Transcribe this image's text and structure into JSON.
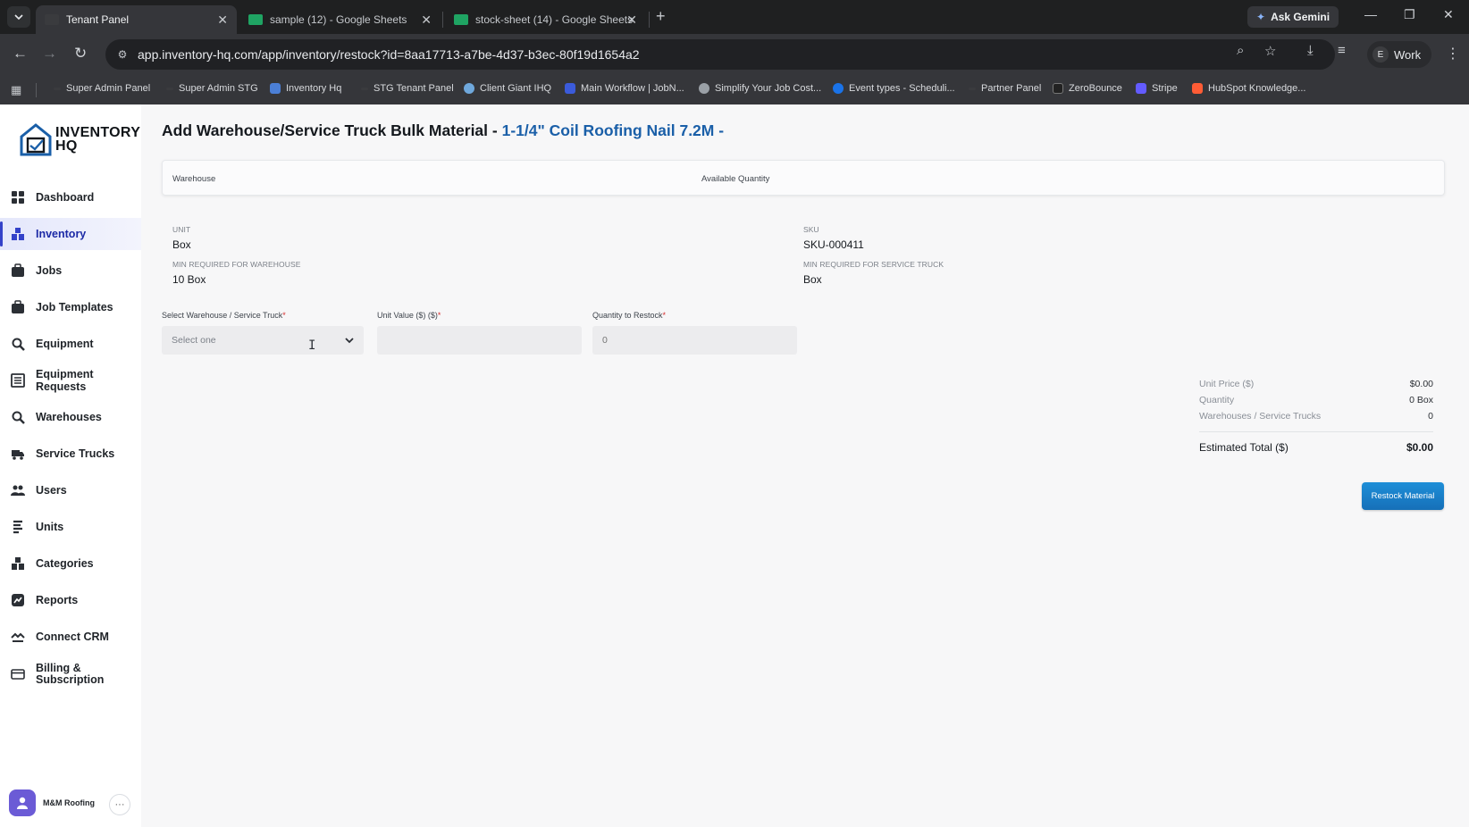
{
  "browser": {
    "tabs": [
      {
        "title": "Tenant Panel",
        "active": true
      },
      {
        "title": "sample (12) - Google Sheets",
        "active": false
      },
      {
        "title": "stock-sheet (14) - Google Sheets",
        "active": false
      }
    ],
    "ask_gemini": "Ask Gemini",
    "url": "app.inventory-hq.com/app/inventory/restock?id=8aa17713-a7be-4d37-b3ec-80f19d1654a2",
    "profile_initial": "E",
    "profile_label": "Work",
    "bookmarks": [
      "Super Admin Panel",
      "Super Admin STG",
      "Inventory Hq",
      "STG Tenant Panel",
      "Client Giant IHQ",
      "Main Workflow | JobN...",
      "Simplify Your Job Cost...",
      "Event types - Scheduli...",
      "Partner Panel",
      "ZeroBounce",
      "Stripe",
      "HubSpot Knowledge..."
    ]
  },
  "brand": {
    "line1": "INVENTORY",
    "line2": "HQ"
  },
  "sidebar": {
    "items": [
      {
        "label": "Dashboard",
        "icon": "dashboard-icon"
      },
      {
        "label": "Inventory",
        "icon": "inventory-icon",
        "active": true
      },
      {
        "label": "Jobs",
        "icon": "jobs-icon"
      },
      {
        "label": "Job Templates",
        "icon": "job-templates-icon"
      },
      {
        "label": "Equipment",
        "icon": "equipment-icon"
      },
      {
        "label": "Equipment Requests",
        "icon": "equipment-requests-icon"
      },
      {
        "label": "Warehouses",
        "icon": "warehouses-icon"
      },
      {
        "label": "Service Trucks",
        "icon": "truck-icon"
      },
      {
        "label": "Users",
        "icon": "users-icon"
      },
      {
        "label": "Units",
        "icon": "units-icon"
      },
      {
        "label": "Categories",
        "icon": "categories-icon"
      },
      {
        "label": "Reports",
        "icon": "reports-icon"
      },
      {
        "label": "Connect CRM",
        "icon": "connect-crm-icon"
      },
      {
        "label_line1": "Billing &",
        "label_line2": "Subscription",
        "icon": "billing-icon"
      }
    ],
    "account_name": "M&M Roofing",
    "account_more": "···"
  },
  "page": {
    "title_prefix": "Add Warehouse/Service Truck Bulk Material - ",
    "title_item": "1-1/4\" Coil Roofing Nail 7.2M -",
    "table_headers": {
      "warehouse": "Warehouse",
      "available_quantity": "Available Quantity"
    },
    "details": {
      "unit_label": "UNIT",
      "unit_value": "Box",
      "sku_label": "SKU",
      "sku_value": "SKU-000411",
      "min_wh_label": "MIN REQUIRED FOR WAREHOUSE",
      "min_wh_value": "10 Box",
      "min_truck_label": "MIN REQUIRED FOR SERVICE TRUCK",
      "min_truck_value": "Box"
    },
    "form": {
      "select_label": "Select Warehouse / Service Truck",
      "select_placeholder": "Select one",
      "unit_value_label": "Unit Value ($) ($)",
      "unit_value_value": "",
      "qty_label": "Quantity to Restock",
      "qty_placeholder": "0",
      "required_mark": "*"
    },
    "summary": {
      "unit_price_label": "Unit Price ($)",
      "unit_price_value": "$0.00",
      "quantity_label": "Quantity",
      "quantity_value": "0 Box",
      "wh_trucks_label": "Warehouses / Service Trucks",
      "wh_trucks_value": "0",
      "total_label": "Estimated Total ($)",
      "total_value": "$0.00"
    },
    "restock_button": "Restock Material"
  },
  "colors": {
    "accent": "#1a5fa8",
    "button": "#1670b8",
    "active_nav": "#3442c9"
  }
}
